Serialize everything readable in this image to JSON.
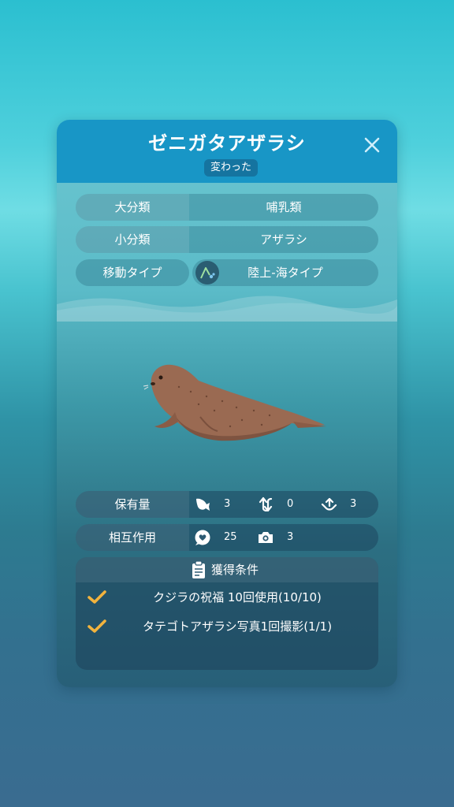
{
  "header": {
    "title": "ゼニガタアザラシ",
    "subtitle": "変わった"
  },
  "info": {
    "major_class_label": "大分類",
    "major_class_value": "哺乳類",
    "minor_class_label": "小分類",
    "minor_class_value": "アザラシ",
    "move_type_label": "移動タイプ",
    "move_type_value": "陸上-海タイプ"
  },
  "holdings": {
    "label": "保有量",
    "counts": [
      "3",
      "0",
      "3"
    ]
  },
  "interaction": {
    "label": "相互作用",
    "hearts": "25",
    "photos": "3"
  },
  "conditions": {
    "title": "獲得条件",
    "items": [
      "クジラの祝福 10回使用(10/10)",
      "タテゴトアザラシ写真1回撮影(1/1)"
    ]
  },
  "colors": {
    "header": "#1896c6",
    "check": "#f2b33d",
    "seal": "#9a6a52"
  },
  "icons": {
    "close": "close-icon",
    "move_type": "land-sea-icon",
    "fish": "fish-icon",
    "recycle": "exchange-arrows-icon",
    "hand": "hand-give-icon",
    "heart_bubble": "heart-bubble-icon",
    "camera": "camera-icon",
    "clipboard": "clipboard-icon",
    "check": "check-icon"
  }
}
